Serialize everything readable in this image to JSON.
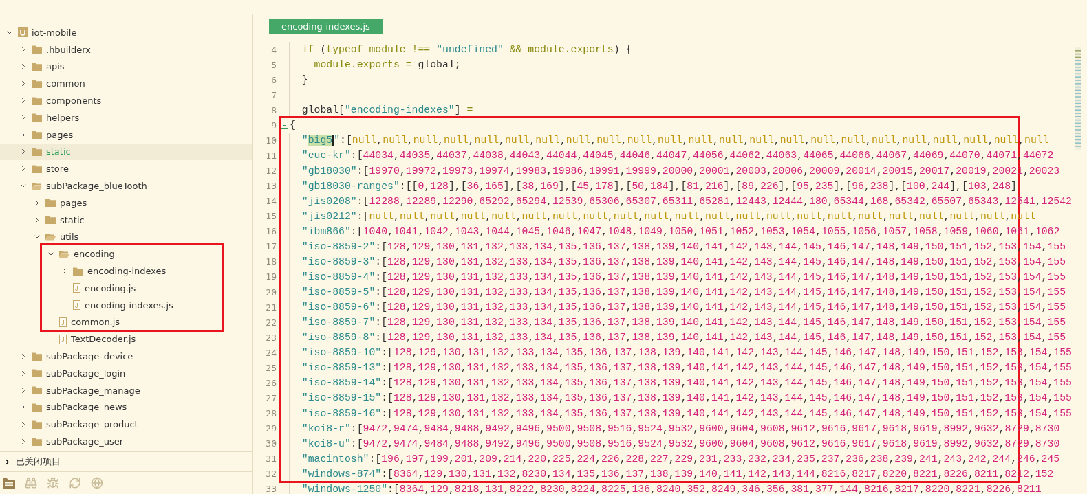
{
  "sidebar": {
    "tree": [
      {
        "label": "iot-mobile",
        "kind": "project",
        "expanded": true,
        "selected": false,
        "children": [
          {
            "label": ".hbuilderx",
            "kind": "folder",
            "expanded": false,
            "selected": false
          },
          {
            "label": "apis",
            "kind": "folder",
            "expanded": false,
            "selected": false
          },
          {
            "label": "common",
            "kind": "folder",
            "expanded": false,
            "selected": false
          },
          {
            "label": "components",
            "kind": "folder",
            "expanded": false,
            "selected": false
          },
          {
            "label": "helpers",
            "kind": "folder",
            "expanded": false,
            "selected": false
          },
          {
            "label": "pages",
            "kind": "folder",
            "expanded": false,
            "selected": false
          },
          {
            "label": "static",
            "kind": "folder",
            "expanded": false,
            "selected": true
          },
          {
            "label": "store",
            "kind": "folder",
            "expanded": false,
            "selected": false
          },
          {
            "label": "subPackage_blueTooth",
            "kind": "folder",
            "expanded": true,
            "selected": false,
            "children": [
              {
                "label": "pages",
                "kind": "folder",
                "expanded": false,
                "selected": false
              },
              {
                "label": "static",
                "kind": "folder",
                "expanded": false,
                "selected": false
              },
              {
                "label": "utils",
                "kind": "folder",
                "expanded": true,
                "selected": false,
                "children": [
                  {
                    "label": "encoding",
                    "kind": "folder",
                    "expanded": true,
                    "selected": false,
                    "children": [
                      {
                        "label": "encoding-indexes",
                        "kind": "folder",
                        "expanded": false,
                        "selected": false
                      },
                      {
                        "label": "encoding.js",
                        "kind": "file",
                        "selected": false
                      },
                      {
                        "label": "encoding-indexes.js",
                        "kind": "file",
                        "selected": false
                      }
                    ]
                  },
                  {
                    "label": "common.js",
                    "kind": "file",
                    "selected": false
                  },
                  {
                    "label": "TextDecoder.js",
                    "kind": "file",
                    "selected": false
                  }
                ]
              }
            ]
          },
          {
            "label": "subPackage_device",
            "kind": "folder",
            "expanded": false,
            "selected": false
          },
          {
            "label": "subPackage_login",
            "kind": "folder",
            "expanded": false,
            "selected": false
          },
          {
            "label": "subPackage_manage",
            "kind": "folder",
            "expanded": false,
            "selected": false
          },
          {
            "label": "subPackage_news",
            "kind": "folder",
            "expanded": false,
            "selected": false
          },
          {
            "label": "subPackage_product",
            "kind": "folder",
            "expanded": false,
            "selected": false
          },
          {
            "label": "subPackage_user",
            "kind": "folder",
            "expanded": false,
            "selected": false
          }
        ]
      }
    ],
    "closed_projects": {
      "label": "已关闭项目",
      "expanded": false
    }
  },
  "editor": {
    "tabs": [
      {
        "label": "encoding-indexes.js",
        "selected": true
      }
    ],
    "lines": [
      {
        "number": "4",
        "tokens": [
          {
            "kind": "word",
            "text": "  if"
          },
          {
            "kind": "plain",
            "text": " ("
          },
          {
            "kind": "word",
            "text": "typeof module !== "
          },
          {
            "kind": "str",
            "text": "\"undefined\""
          },
          {
            "kind": "word",
            "text": " && module.exports"
          },
          {
            "kind": "plain",
            "text": ") {"
          }
        ]
      },
      {
        "number": "5",
        "tokens": [
          {
            "kind": "word",
            "text": "    module.exports"
          },
          {
            "kind": "word",
            "text": " = "
          },
          {
            "kind": "plain",
            "text": "global;"
          }
        ]
      },
      {
        "number": "6",
        "tokens": [
          {
            "kind": "plain",
            "text": "  }"
          }
        ]
      },
      {
        "number": "7"
      },
      {
        "number": "8",
        "tokens": [
          {
            "kind": "plain",
            "text": "  global["
          },
          {
            "kind": "str",
            "text": "\"encoding-indexes\""
          },
          {
            "kind": "plain",
            "text": "] "
          },
          {
            "kind": "word",
            "text": "="
          }
        ]
      },
      {
        "number": "9",
        "fold": true,
        "tokens": [
          {
            "kind": "plain",
            "text": "{"
          }
        ]
      },
      {
        "number": "10",
        "tokens": [
          {
            "kind": "str",
            "text": "  \""
          },
          {
            "kind": "match",
            "text": "big5"
          },
          {
            "kind": "str",
            "text": "\""
          },
          {
            "kind": "plain",
            "text": ":["
          },
          {
            "kind": "list",
            "text": "null,null,null,null,null,null,null,null,null,null,null,null,null,null,null,null,null,null,null,null,null,null,null"
          }
        ]
      },
      {
        "number": "11",
        "tokens": [
          {
            "kind": "str",
            "text": "  \"euc-kr\""
          },
          {
            "kind": "plain",
            "text": ":["
          },
          {
            "kind": "list",
            "text": "44034,44035,44037,44038,44043,44044,44045,44046,44047,44056,44062,44063,44065,44066,44067,44069,44070,44071,44072"
          }
        ]
      },
      {
        "number": "12",
        "tokens": [
          {
            "kind": "str",
            "text": "  \"gb18030\""
          },
          {
            "kind": "plain",
            "text": ":["
          },
          {
            "kind": "list",
            "text": "19970,19972,19973,19974,19983,19986,19991,19999,20000,20001,20003,20006,20009,20014,20015,20017,20019,20021,20023"
          }
        ]
      },
      {
        "number": "13",
        "tokens": [
          {
            "kind": "str",
            "text": "  \"gb18030-ranges\""
          },
          {
            "kind": "plain",
            "text": ":["
          },
          {
            "kind": "list",
            "text": "[0,128],[36,165],[38,169],[45,178],[50,184],[81,216],[89,226],[95,235],[96,238],[100,244],[103,248]"
          }
        ]
      },
      {
        "number": "14",
        "tokens": [
          {
            "kind": "str",
            "text": "  \"jis0208\""
          },
          {
            "kind": "plain",
            "text": ":["
          },
          {
            "kind": "list",
            "text": "12288,12289,12290,65292,65294,12539,65306,65307,65311,65281,12443,12444,180,65344,168,65342,65507,65343,12541,12542"
          }
        ]
      },
      {
        "number": "15",
        "tokens": [
          {
            "kind": "str",
            "text": "  \"jis0212\""
          },
          {
            "kind": "plain",
            "text": ":["
          },
          {
            "kind": "list",
            "text": "null,null,null,null,null,null,null,null,null,null,null,null,null,null,null,null,null,null,null,null,null,null"
          }
        ]
      },
      {
        "number": "16",
        "tokens": [
          {
            "kind": "str",
            "text": "  \"ibm866\""
          },
          {
            "kind": "plain",
            "text": ":["
          },
          {
            "kind": "list",
            "text": "1040,1041,1042,1043,1044,1045,1046,1047,1048,1049,1050,1051,1052,1053,1054,1055,1056,1057,1058,1059,1060,1061,1062"
          }
        ]
      },
      {
        "number": "17",
        "tokens": [
          {
            "kind": "str",
            "text": "  \"iso-8859-2\""
          },
          {
            "kind": "plain",
            "text": ":["
          },
          {
            "kind": "list",
            "text": "128,129,130,131,132,133,134,135,136,137,138,139,140,141,142,143,144,145,146,147,148,149,150,151,152,153,154,155"
          }
        ]
      },
      {
        "number": "18",
        "tokens": [
          {
            "kind": "str",
            "text": "  \"iso-8859-3\""
          },
          {
            "kind": "plain",
            "text": ":["
          },
          {
            "kind": "list",
            "text": "128,129,130,131,132,133,134,135,136,137,138,139,140,141,142,143,144,145,146,147,148,149,150,151,152,153,154,155"
          }
        ]
      },
      {
        "number": "19",
        "tokens": [
          {
            "kind": "str",
            "text": "  \"iso-8859-4\""
          },
          {
            "kind": "plain",
            "text": ":["
          },
          {
            "kind": "list",
            "text": "128,129,130,131,132,133,134,135,136,137,138,139,140,141,142,143,144,145,146,147,148,149,150,151,152,153,154,155"
          }
        ]
      },
      {
        "number": "20",
        "tokens": [
          {
            "kind": "str",
            "text": "  \"iso-8859-5\""
          },
          {
            "kind": "plain",
            "text": ":["
          },
          {
            "kind": "list",
            "text": "128,129,130,131,132,133,134,135,136,137,138,139,140,141,142,143,144,145,146,147,148,149,150,151,152,153,154,155"
          }
        ]
      },
      {
        "number": "21",
        "tokens": [
          {
            "kind": "str",
            "text": "  \"iso-8859-6\""
          },
          {
            "kind": "plain",
            "text": ":["
          },
          {
            "kind": "list",
            "text": "128,129,130,131,132,133,134,135,136,137,138,139,140,141,142,143,144,145,146,147,148,149,150,151,152,153,154,155"
          }
        ]
      },
      {
        "number": "22",
        "tokens": [
          {
            "kind": "str",
            "text": "  \"iso-8859-7\""
          },
          {
            "kind": "plain",
            "text": ":["
          },
          {
            "kind": "list",
            "text": "128,129,130,131,132,133,134,135,136,137,138,139,140,141,142,143,144,145,146,147,148,149,150,151,152,153,154,155"
          }
        ]
      },
      {
        "number": "23",
        "tokens": [
          {
            "kind": "str",
            "text": "  \"iso-8859-8\""
          },
          {
            "kind": "plain",
            "text": ":["
          },
          {
            "kind": "list",
            "text": "128,129,130,131,132,133,134,135,136,137,138,139,140,141,142,143,144,145,146,147,148,149,150,151,152,153,154,155"
          }
        ]
      },
      {
        "number": "24",
        "tokens": [
          {
            "kind": "str",
            "text": "  \"iso-8859-10\""
          },
          {
            "kind": "plain",
            "text": ":["
          },
          {
            "kind": "list",
            "text": "128,129,130,131,132,133,134,135,136,137,138,139,140,141,142,143,144,145,146,147,148,149,150,151,152,153,154,155"
          }
        ]
      },
      {
        "number": "25",
        "tokens": [
          {
            "kind": "str",
            "text": "  \"iso-8859-13\""
          },
          {
            "kind": "plain",
            "text": ":["
          },
          {
            "kind": "list",
            "text": "128,129,130,131,132,133,134,135,136,137,138,139,140,141,142,143,144,145,146,147,148,149,150,151,152,153,154,155"
          }
        ]
      },
      {
        "number": "26",
        "tokens": [
          {
            "kind": "str",
            "text": "  \"iso-8859-14\""
          },
          {
            "kind": "plain",
            "text": ":["
          },
          {
            "kind": "list",
            "text": "128,129,130,131,132,133,134,135,136,137,138,139,140,141,142,143,144,145,146,147,148,149,150,151,152,153,154,155"
          }
        ]
      },
      {
        "number": "27",
        "tokens": [
          {
            "kind": "str",
            "text": "  \"iso-8859-15\""
          },
          {
            "kind": "plain",
            "text": ":["
          },
          {
            "kind": "list",
            "text": "128,129,130,131,132,133,134,135,136,137,138,139,140,141,142,143,144,145,146,147,148,149,150,151,152,153,154,155"
          }
        ]
      },
      {
        "number": "28",
        "tokens": [
          {
            "kind": "str",
            "text": "  \"iso-8859-16\""
          },
          {
            "kind": "plain",
            "text": ":["
          },
          {
            "kind": "list",
            "text": "128,129,130,131,132,133,134,135,136,137,138,139,140,141,142,143,144,145,146,147,148,149,150,151,152,153,154,155"
          }
        ]
      },
      {
        "number": "29",
        "tokens": [
          {
            "kind": "str",
            "text": "  \"koi8-r\""
          },
          {
            "kind": "plain",
            "text": ":["
          },
          {
            "kind": "list",
            "text": "9472,9474,9484,9488,9492,9496,9500,9508,9516,9524,9532,9600,9604,9608,9612,9616,9617,9618,9619,8992,9632,8729,8730"
          }
        ]
      },
      {
        "number": "30",
        "tokens": [
          {
            "kind": "str",
            "text": "  \"koi8-u\""
          },
          {
            "kind": "plain",
            "text": ":["
          },
          {
            "kind": "list",
            "text": "9472,9474,9484,9488,9492,9496,9500,9508,9516,9524,9532,9600,9604,9608,9612,9616,9617,9618,9619,8992,9632,8729,8730"
          }
        ]
      },
      {
        "number": "31",
        "tokens": [
          {
            "kind": "str",
            "text": "  \"macintosh\""
          },
          {
            "kind": "plain",
            "text": ":["
          },
          {
            "kind": "list",
            "text": "196,197,199,201,209,214,220,225,224,226,228,227,229,231,233,232,234,235,237,236,238,239,241,243,242,244,246,245"
          }
        ]
      },
      {
        "number": "32",
        "tokens": [
          {
            "kind": "str",
            "text": "  \"windows-874\""
          },
          {
            "kind": "plain",
            "text": ":["
          },
          {
            "kind": "list",
            "text": "8364,129,130,131,132,8230,134,135,136,137,138,139,140,141,142,143,144,8216,8217,8220,8221,8226,8211,8212,152"
          }
        ]
      },
      {
        "number": "33",
        "tokens": [
          {
            "kind": "str",
            "text": "  \"windows-1250\""
          },
          {
            "kind": "plain",
            "text": ":["
          },
          {
            "kind": "list",
            "text": "8364,129,8218,131,8222,8230,8224,8225,136,8240,352,8249,346,356,381,377,144,8216,8217,8220,8221,8226,8211"
          }
        ]
      }
    ]
  }
}
